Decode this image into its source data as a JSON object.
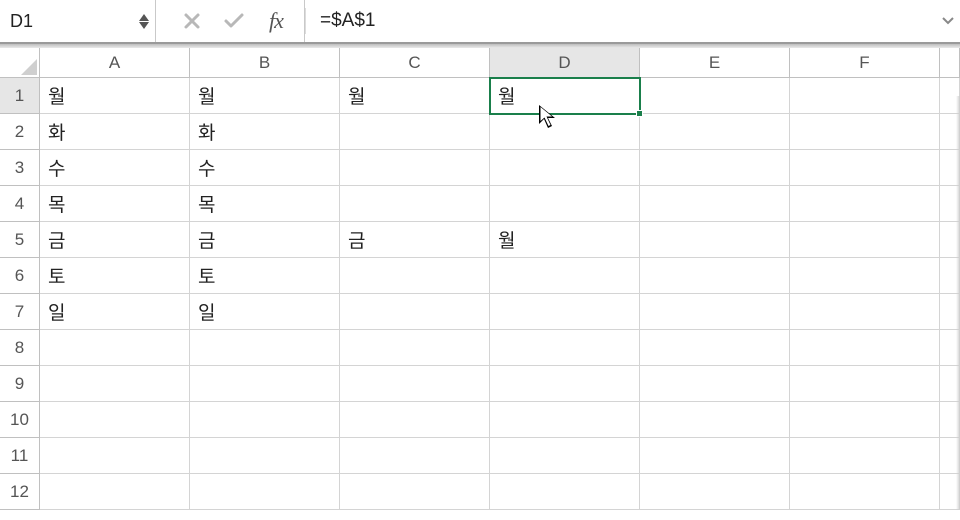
{
  "name_box": "D1",
  "formula": "=$A$1",
  "fx_label": "fx",
  "columns": [
    "A",
    "B",
    "C",
    "D",
    "E",
    "F"
  ],
  "active_col": "D",
  "active_row": 1,
  "row_count": 12,
  "cells": {
    "r1": {
      "A": "월",
      "B": "월",
      "C": "월",
      "D": "월"
    },
    "r2": {
      "A": "화",
      "B": "화"
    },
    "r3": {
      "A": "수",
      "B": "수"
    },
    "r4": {
      "A": "목",
      "B": "목"
    },
    "r5": {
      "A": "금",
      "B": "금",
      "C": "금",
      "D": "월"
    },
    "r6": {
      "A": "토",
      "B": "토"
    },
    "r7": {
      "A": "일",
      "B": "일"
    }
  }
}
